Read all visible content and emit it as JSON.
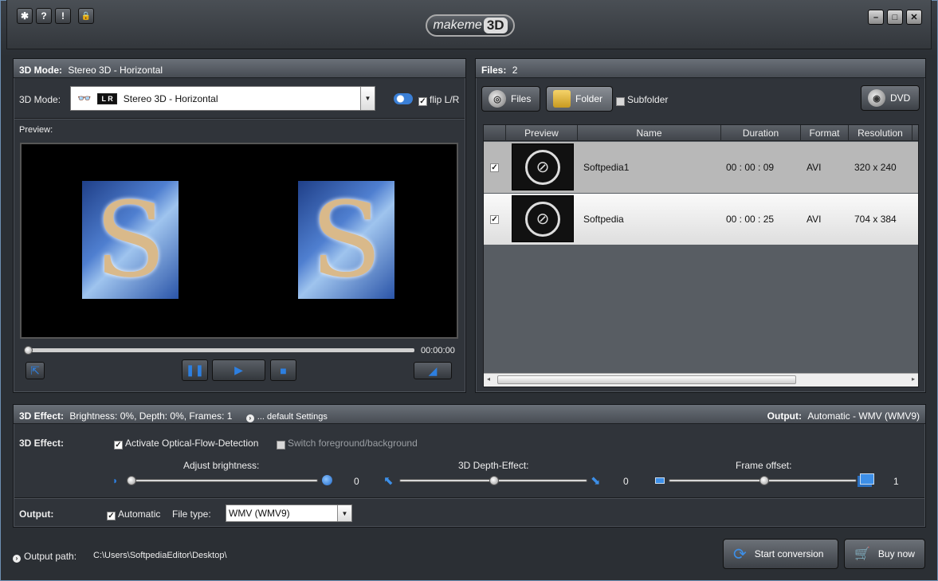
{
  "titlebar": {
    "logo_prefix": "makeme",
    "logo_badge": "3D",
    "tool_icons": [
      "gear-icon",
      "help-icon",
      "info-icon",
      "lock-icon"
    ],
    "tool_glyphs": [
      "✱",
      "?",
      "!",
      "🔒"
    ],
    "window_glyphs": {
      "minimize": "–",
      "maximize": "□",
      "close": "✕"
    }
  },
  "mode_panel": {
    "header_label": "3D Mode:",
    "header_value": "Stereo 3D - Horizontal",
    "mode_label": "3D Mode:",
    "mode_lr_badge": "L R",
    "mode_selected": "Stereo 3D - Horizontal",
    "flip_label": "flip L/R",
    "flip_checked": true,
    "preview_label": "Preview:",
    "preview_letter": "S",
    "time": "00:00:00"
  },
  "files_panel": {
    "header_label": "Files:",
    "header_count": "2",
    "files_btn": "Files",
    "folder_btn": "Folder",
    "subfolder_label": "Subfolder",
    "dvd_btn": "DVD",
    "columns": [
      "Preview",
      "Name",
      "Duration",
      "Format",
      "Resolution"
    ],
    "rows": [
      {
        "name": "Softpedia1",
        "duration": "00 : 00 : 09",
        "format": "AVI",
        "resolution": "320 x 240"
      },
      {
        "name": "Softpedia",
        "duration": "00 : 00 : 25",
        "format": "AVI",
        "resolution": "704 x 384"
      }
    ]
  },
  "effect_panel": {
    "header_label": "3D Effect:",
    "header_value": "Brightness: 0%, Depth: 0%, Frames: 1",
    "default_settings": "... default Settings",
    "output_label": "Output:",
    "output_value": "Automatic - WMV (WMV9)",
    "effect_label": "3D Effect:",
    "optical_flow": "Activate Optical-Flow-Detection",
    "switch_fg": "Switch foreground/background",
    "brightness_label": "Adjust brightness:",
    "brightness_value": "0",
    "depth_label": "3D Depth-Effect:",
    "depth_value": "0",
    "frame_label": "Frame offset:",
    "frame_value": "1",
    "out_row_label": "Output:",
    "automatic_label": "Automatic",
    "filetype_label": "File type:",
    "filetype_value": "WMV (WMV9)"
  },
  "footer": {
    "output_path_label": "Output path:",
    "output_path": "C:\\Users\\SoftpediaEditor\\Desktop\\",
    "start_btn": "Start conversion",
    "buy_btn": "Buy now"
  },
  "colors": {
    "accent": "#2d7fe0",
    "panel": "#30343a",
    "header": "#5a6068"
  }
}
